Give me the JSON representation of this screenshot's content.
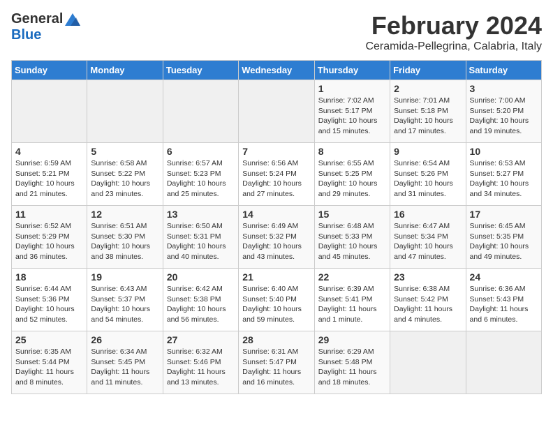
{
  "header": {
    "logo_general": "General",
    "logo_blue": "Blue",
    "month": "February 2024",
    "location": "Ceramida-Pellegrina, Calabria, Italy"
  },
  "days_of_week": [
    "Sunday",
    "Monday",
    "Tuesday",
    "Wednesday",
    "Thursday",
    "Friday",
    "Saturday"
  ],
  "weeks": [
    [
      {
        "day": "",
        "info": ""
      },
      {
        "day": "",
        "info": ""
      },
      {
        "day": "",
        "info": ""
      },
      {
        "day": "",
        "info": ""
      },
      {
        "day": "1",
        "info": "Sunrise: 7:02 AM\nSunset: 5:17 PM\nDaylight: 10 hours\nand 15 minutes."
      },
      {
        "day": "2",
        "info": "Sunrise: 7:01 AM\nSunset: 5:18 PM\nDaylight: 10 hours\nand 17 minutes."
      },
      {
        "day": "3",
        "info": "Sunrise: 7:00 AM\nSunset: 5:20 PM\nDaylight: 10 hours\nand 19 minutes."
      }
    ],
    [
      {
        "day": "4",
        "info": "Sunrise: 6:59 AM\nSunset: 5:21 PM\nDaylight: 10 hours\nand 21 minutes."
      },
      {
        "day": "5",
        "info": "Sunrise: 6:58 AM\nSunset: 5:22 PM\nDaylight: 10 hours\nand 23 minutes."
      },
      {
        "day": "6",
        "info": "Sunrise: 6:57 AM\nSunset: 5:23 PM\nDaylight: 10 hours\nand 25 minutes."
      },
      {
        "day": "7",
        "info": "Sunrise: 6:56 AM\nSunset: 5:24 PM\nDaylight: 10 hours\nand 27 minutes."
      },
      {
        "day": "8",
        "info": "Sunrise: 6:55 AM\nSunset: 5:25 PM\nDaylight: 10 hours\nand 29 minutes."
      },
      {
        "day": "9",
        "info": "Sunrise: 6:54 AM\nSunset: 5:26 PM\nDaylight: 10 hours\nand 31 minutes."
      },
      {
        "day": "10",
        "info": "Sunrise: 6:53 AM\nSunset: 5:27 PM\nDaylight: 10 hours\nand 34 minutes."
      }
    ],
    [
      {
        "day": "11",
        "info": "Sunrise: 6:52 AM\nSunset: 5:29 PM\nDaylight: 10 hours\nand 36 minutes."
      },
      {
        "day": "12",
        "info": "Sunrise: 6:51 AM\nSunset: 5:30 PM\nDaylight: 10 hours\nand 38 minutes."
      },
      {
        "day": "13",
        "info": "Sunrise: 6:50 AM\nSunset: 5:31 PM\nDaylight: 10 hours\nand 40 minutes."
      },
      {
        "day": "14",
        "info": "Sunrise: 6:49 AM\nSunset: 5:32 PM\nDaylight: 10 hours\nand 43 minutes."
      },
      {
        "day": "15",
        "info": "Sunrise: 6:48 AM\nSunset: 5:33 PM\nDaylight: 10 hours\nand 45 minutes."
      },
      {
        "day": "16",
        "info": "Sunrise: 6:47 AM\nSunset: 5:34 PM\nDaylight: 10 hours\nand 47 minutes."
      },
      {
        "day": "17",
        "info": "Sunrise: 6:45 AM\nSunset: 5:35 PM\nDaylight: 10 hours\nand 49 minutes."
      }
    ],
    [
      {
        "day": "18",
        "info": "Sunrise: 6:44 AM\nSunset: 5:36 PM\nDaylight: 10 hours\nand 52 minutes."
      },
      {
        "day": "19",
        "info": "Sunrise: 6:43 AM\nSunset: 5:37 PM\nDaylight: 10 hours\nand 54 minutes."
      },
      {
        "day": "20",
        "info": "Sunrise: 6:42 AM\nSunset: 5:38 PM\nDaylight: 10 hours\nand 56 minutes."
      },
      {
        "day": "21",
        "info": "Sunrise: 6:40 AM\nSunset: 5:40 PM\nDaylight: 10 hours\nand 59 minutes."
      },
      {
        "day": "22",
        "info": "Sunrise: 6:39 AM\nSunset: 5:41 PM\nDaylight: 11 hours\nand 1 minute."
      },
      {
        "day": "23",
        "info": "Sunrise: 6:38 AM\nSunset: 5:42 PM\nDaylight: 11 hours\nand 4 minutes."
      },
      {
        "day": "24",
        "info": "Sunrise: 6:36 AM\nSunset: 5:43 PM\nDaylight: 11 hours\nand 6 minutes."
      }
    ],
    [
      {
        "day": "25",
        "info": "Sunrise: 6:35 AM\nSunset: 5:44 PM\nDaylight: 11 hours\nand 8 minutes."
      },
      {
        "day": "26",
        "info": "Sunrise: 6:34 AM\nSunset: 5:45 PM\nDaylight: 11 hours\nand 11 minutes."
      },
      {
        "day": "27",
        "info": "Sunrise: 6:32 AM\nSunset: 5:46 PM\nDaylight: 11 hours\nand 13 minutes."
      },
      {
        "day": "28",
        "info": "Sunrise: 6:31 AM\nSunset: 5:47 PM\nDaylight: 11 hours\nand 16 minutes."
      },
      {
        "day": "29",
        "info": "Sunrise: 6:29 AM\nSunset: 5:48 PM\nDaylight: 11 hours\nand 18 minutes."
      },
      {
        "day": "",
        "info": ""
      },
      {
        "day": "",
        "info": ""
      }
    ]
  ]
}
